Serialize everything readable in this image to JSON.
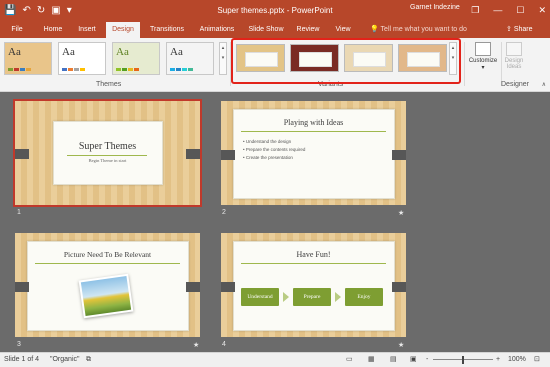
{
  "window": {
    "title": "Super themes.pptx - PowerPoint",
    "controls": {
      "restore": "❐",
      "minimize": "—",
      "maximize": "☐",
      "close": "✕"
    }
  },
  "qat": {
    "save_icon": "💾",
    "undo_icon": "↶",
    "redo_icon": "↻",
    "start_icon": "▣",
    "more_icon": "▾"
  },
  "tabs": [
    "File",
    "Home",
    "Insert",
    "Design",
    "Transitions",
    "Animations",
    "Slide Show",
    "Review",
    "View"
  ],
  "active_tab": "Design",
  "tell_me": {
    "icon": "💡",
    "text": "Tell me what you want to do"
  },
  "user": {
    "name": "Garnet Indezine"
  },
  "share": {
    "label": "Share"
  },
  "ribbon": {
    "themes": {
      "label": "Themes",
      "items": [
        {
          "label": "Aa",
          "bg": "#e9c58a"
        },
        {
          "label": "Aa",
          "bg": "#ffffff"
        },
        {
          "label": "Aa",
          "bg": "#e6ebd0"
        },
        {
          "label": "Aa",
          "bg": "#f4f4f4"
        }
      ]
    },
    "variants": {
      "label": "Variants",
      "items": [
        {
          "bg": "#e3c486"
        },
        {
          "bg": "#7a2b24"
        },
        {
          "bg": "#ead8b4"
        },
        {
          "bg": "#e2b88a"
        }
      ]
    },
    "customize": {
      "label": "Customize",
      "arrow": "▾"
    },
    "designer": {
      "label": "Designer",
      "design_ideas": "Design Ideas"
    }
  },
  "slides": [
    {
      "number": "1",
      "title": "Super Themes",
      "subtitle": "Begin Theme in start"
    },
    {
      "number": "2",
      "title": "Playing with Ideas",
      "bullets": [
        "Understand the design",
        "Prepare the contents required",
        "Create the presentation"
      ],
      "star": "★"
    },
    {
      "number": "3",
      "title": "Picture Need To Be Relevant",
      "star": "★"
    },
    {
      "number": "4",
      "title": "Have Fun!",
      "flow": [
        "Understand",
        "Prepare",
        "Enjoy"
      ],
      "star": "★"
    }
  ],
  "status": {
    "slide_info": "Slide 1 of 4",
    "theme_name": "\"Organic\"",
    "zoom": "100%",
    "zoom_minus": "-",
    "zoom_plus": "+"
  },
  "colors": {
    "accent": "#b7472a",
    "highlight": "#e2231a",
    "green": "#7e9e32"
  }
}
